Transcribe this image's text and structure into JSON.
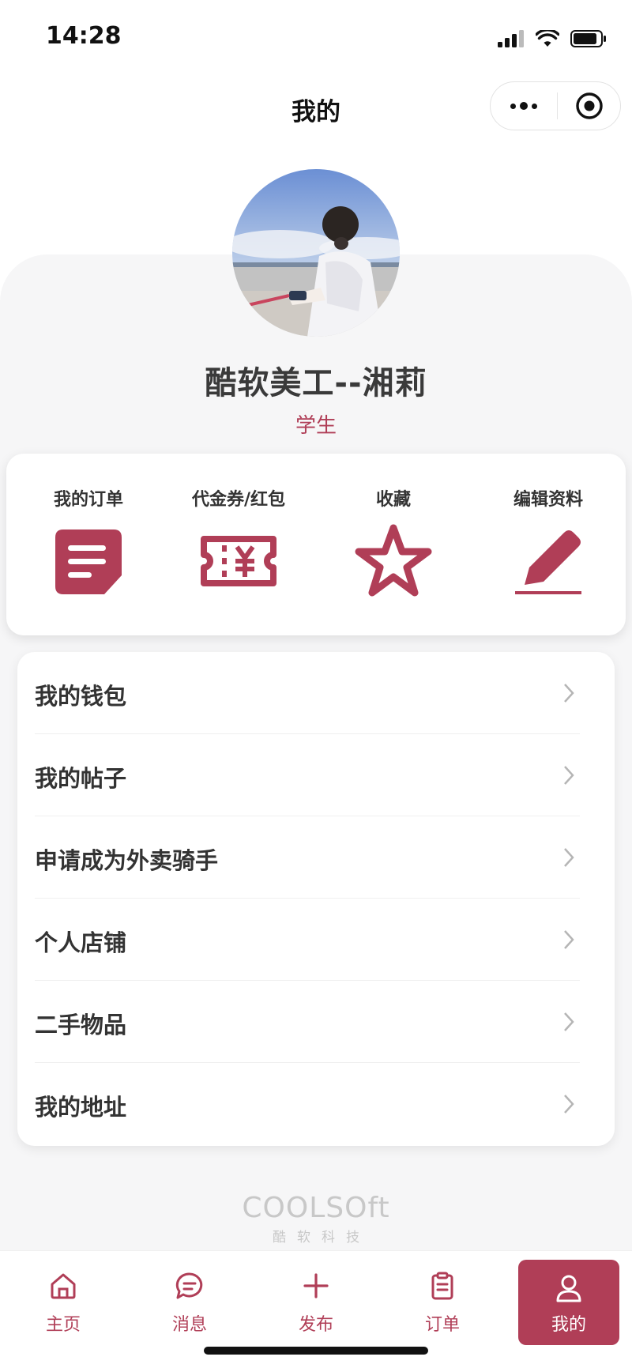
{
  "status_bar": {
    "time": "14:28"
  },
  "nav": {
    "title": "我的"
  },
  "profile": {
    "name": "酷软美工--湘莉",
    "role": "学生"
  },
  "quick_actions": [
    {
      "label": "我的订单",
      "icon": "document-list-icon"
    },
    {
      "label": "代金券/红包",
      "icon": "coupon-yen-icon"
    },
    {
      "label": "收藏",
      "icon": "star-icon"
    },
    {
      "label": "编辑资料",
      "icon": "pencil-icon"
    }
  ],
  "menu": [
    {
      "label": "我的钱包"
    },
    {
      "label": "我的帖子"
    },
    {
      "label": "申请成为外卖骑手"
    },
    {
      "label": "个人店铺"
    },
    {
      "label": "二手物品"
    },
    {
      "label": "我的地址"
    }
  ],
  "brand": {
    "name": "COOLSOft",
    "subtitle": "酷软科技"
  },
  "tabbar": [
    {
      "label": "主页",
      "icon": "home-icon"
    },
    {
      "label": "消息",
      "icon": "chat-bubble-icon"
    },
    {
      "label": "发布",
      "icon": "plus-icon"
    },
    {
      "label": "订单",
      "icon": "clipboard-icon"
    },
    {
      "label": "我的",
      "icon": "user-icon",
      "active": true
    }
  ],
  "colors": {
    "accent": "#b03e57",
    "panel_bg": "#f6f6f7"
  }
}
